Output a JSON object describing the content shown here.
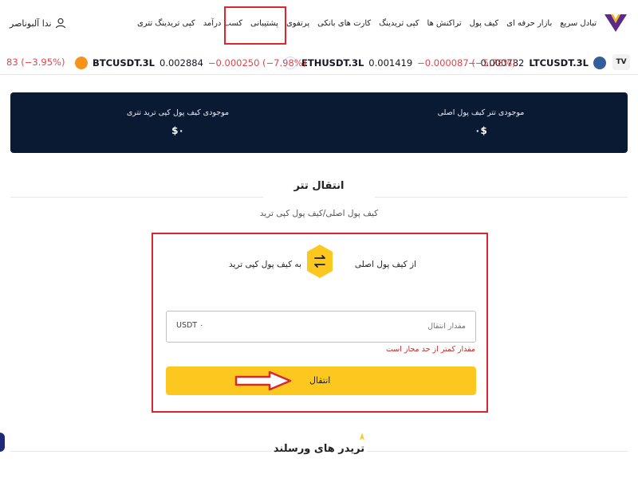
{
  "nav": {
    "items": [
      {
        "label": "تبادل سریع"
      },
      {
        "label": "بازار حرفه ای"
      },
      {
        "label": "کیف پول"
      },
      {
        "label": "تراکنش ها"
      },
      {
        "label": "کپی تریدینگ"
      },
      {
        "label": "کارت های بانکی"
      },
      {
        "label": "پرتفوی"
      },
      {
        "label": "پشتیبانی"
      },
      {
        "label": "کسب درآمد"
      }
    ],
    "active_label": "کپی تریدینگ تتری",
    "user_name": "ندا آلبوناصر"
  },
  "ticker": {
    "badge": "TV",
    "items": [
      {
        "symbol": "LTCUSDT.3L",
        "price": "0.000782",
        "change": "−",
        "coin": "ltc"
      },
      {
        "symbol": "ETHUSDT.3L",
        "price": "0.001419",
        "change": "−0.000087 (−5.78%)",
        "coin": "eth"
      },
      {
        "symbol": "BTCUSDT.3L",
        "price": "0.002884",
        "change": "−0.000250 (−7.98%)",
        "coin": "btc"
      },
      {
        "symbol": "",
        "price": "",
        "change": "83 (−3.95%)",
        "coin": ""
      }
    ]
  },
  "balances": {
    "main_label": "موجودی تتر کیف پول اصلی",
    "main_value": "۰$",
    "kt_label": "موجودی کیف پول کپی ترید تتری",
    "kt_value": "$۰"
  },
  "transfer": {
    "title": "انتقال تتر",
    "subtitle": "کیف پول اصلی/کیف پول کپی ترید",
    "from_label": "از کیف پول اصلی",
    "to_label": "به کیف پول کپی ترید",
    "amount_placeholder": "مقدار انتقال",
    "amount_value": "USDT ۰",
    "error": "مقدار کمتر از حد مجاز است",
    "button_label": "انتقال"
  },
  "bottom": {
    "title": "تریدر های ورسلند"
  },
  "colors": {
    "dark_panel": "#0b1a33",
    "accent_yellow": "#fcc81f",
    "highlight_red": "#d9272e",
    "error_red": "#c72a2a",
    "negative_red": "#e0464e"
  }
}
